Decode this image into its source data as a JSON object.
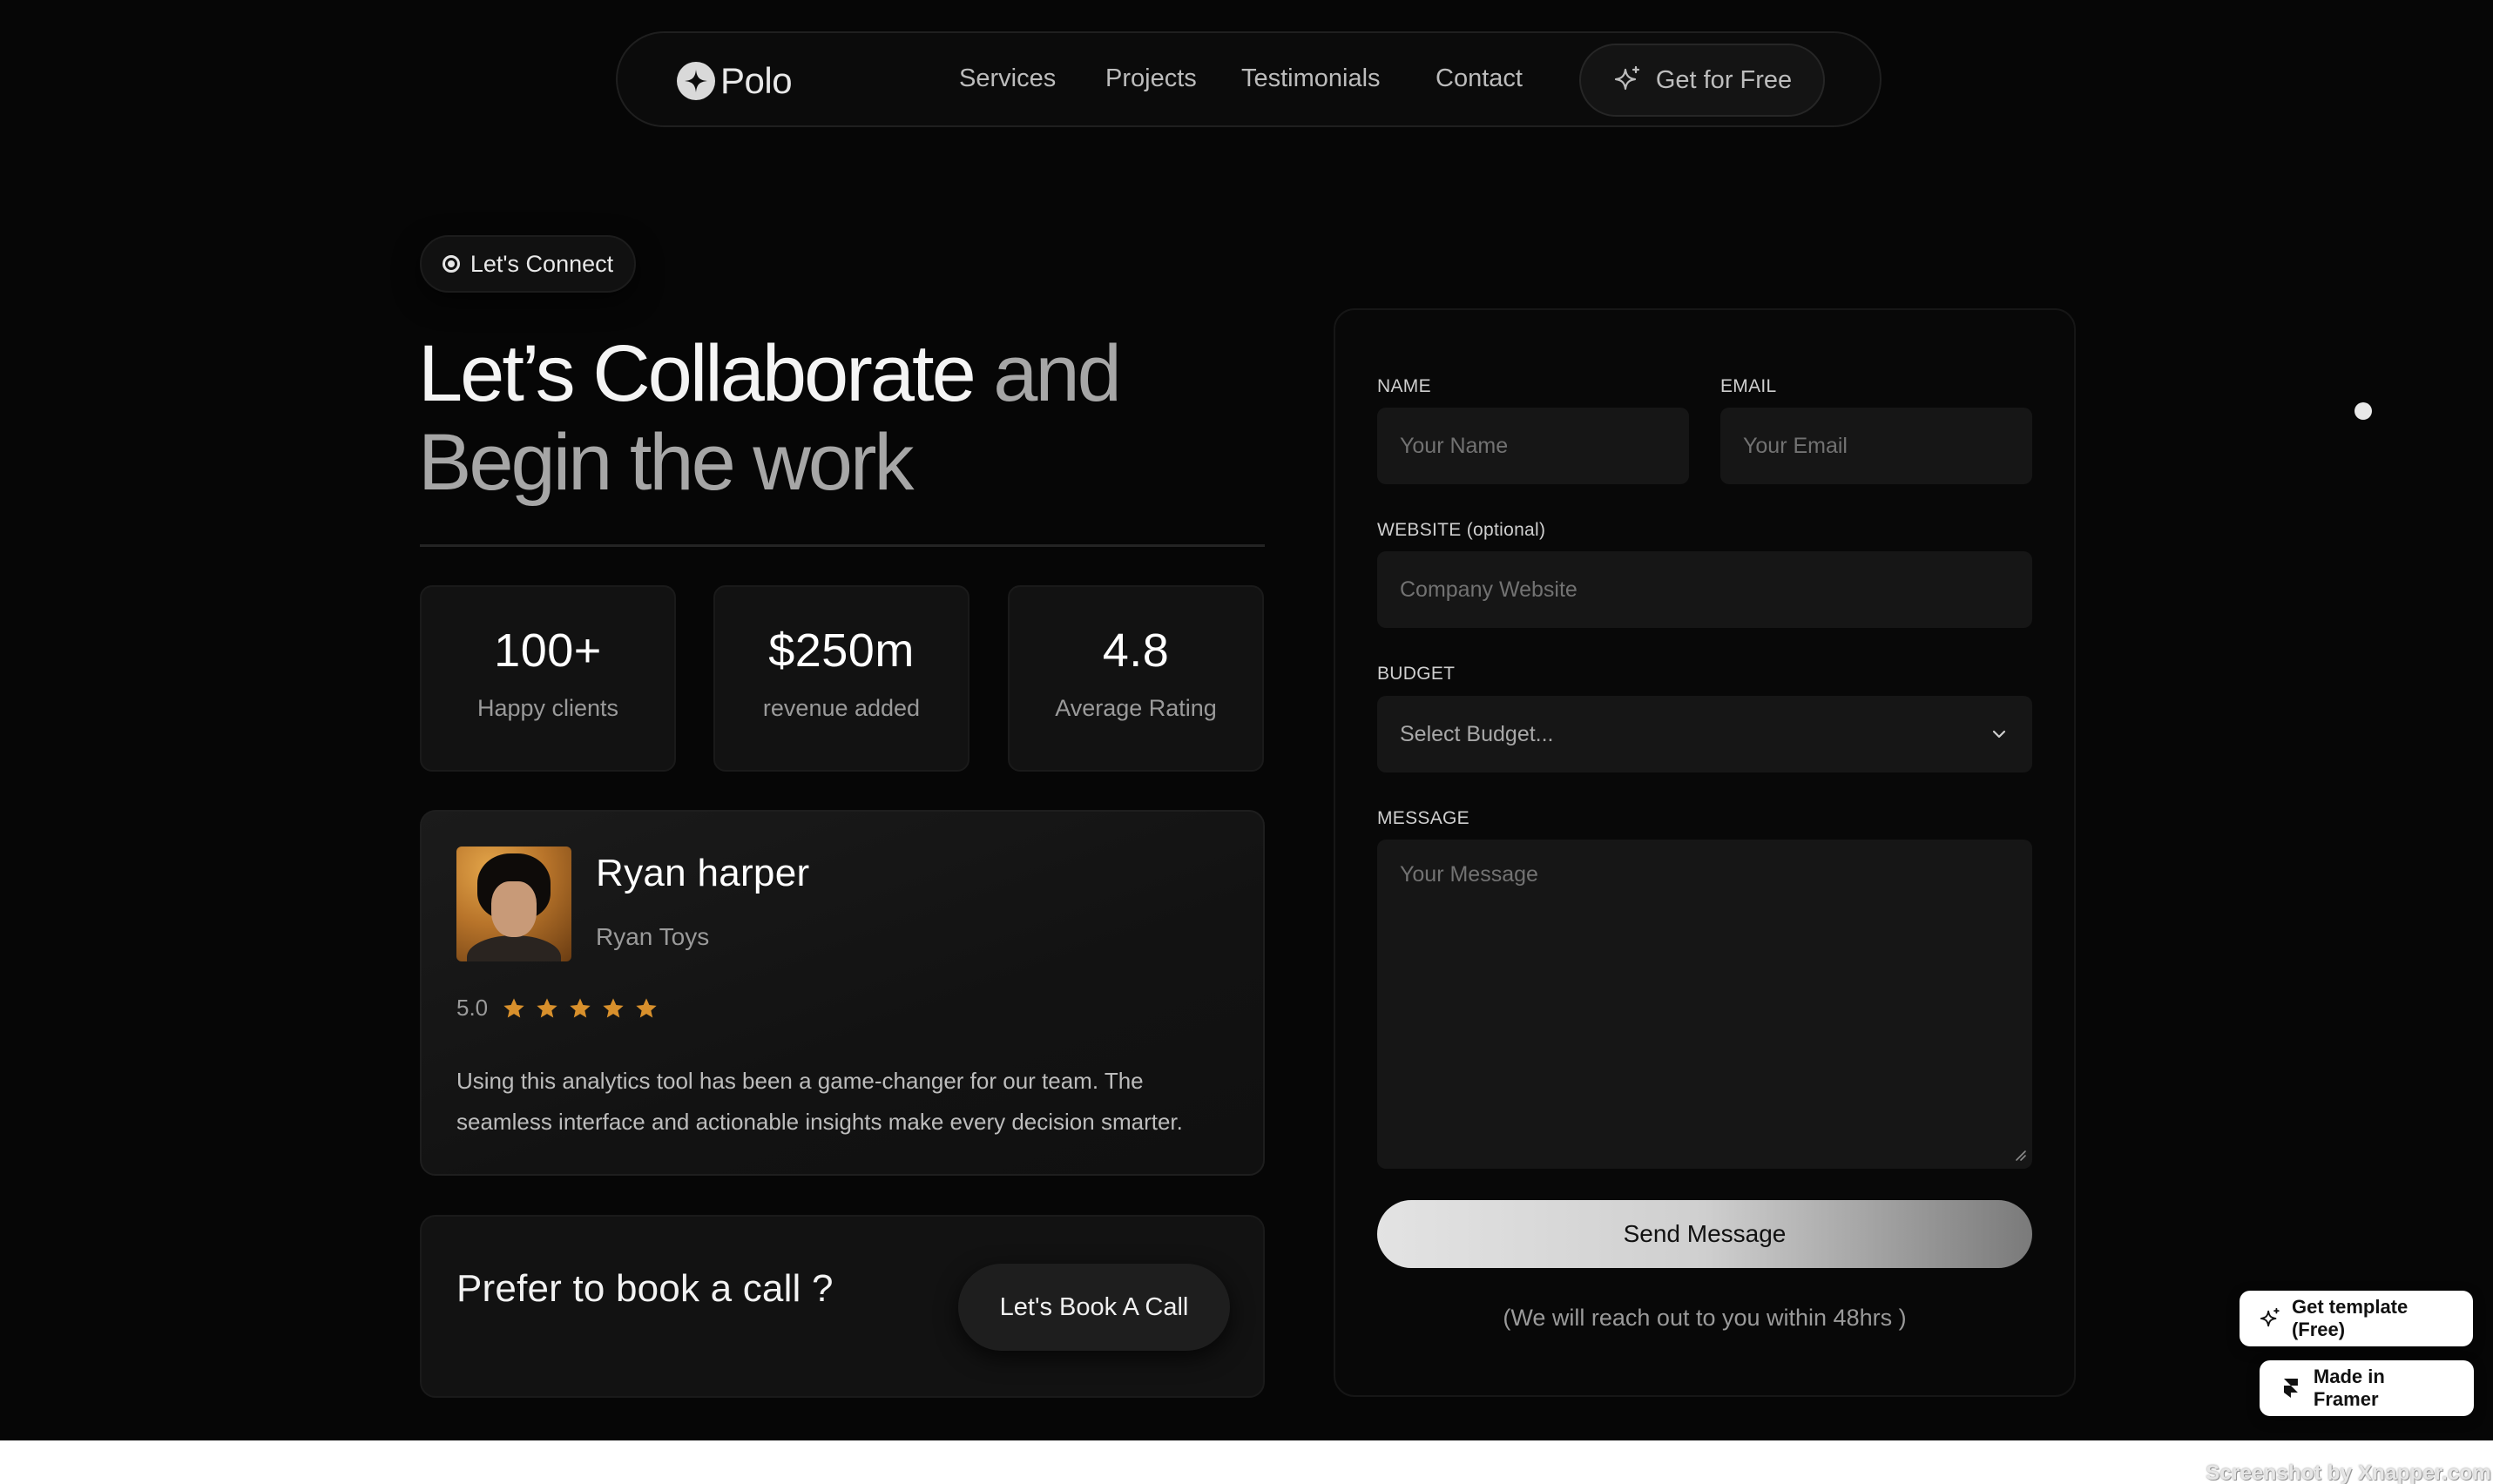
{
  "nav": {
    "brand": "Polo",
    "links": [
      "Services",
      "Projects",
      "Testimonials",
      "Contact"
    ],
    "cta_label": "Get for Free"
  },
  "hero": {
    "tag": "Let's Connect",
    "headline_strong_1": "Let’s Collaborate",
    "headline_muted_1": " and",
    "headline_muted_2": "Begin the work"
  },
  "stats": [
    {
      "value": "100+",
      "label": "Happy clients"
    },
    {
      "value": "$250m",
      "label": "revenue added"
    },
    {
      "value": "4.8",
      "label": "Average Rating"
    }
  ],
  "testimonial": {
    "name": "Ryan harper",
    "company": "Ryan Toys",
    "score": "5.0",
    "stars": 5,
    "quote": "Using this analytics tool has been a game-changer for our team. The seamless interface and actionable insights make every decision smarter."
  },
  "call": {
    "title": "Prefer to book a call ?",
    "button": "Let's Book A Call"
  },
  "form": {
    "name_label": "NAME",
    "name_placeholder": "Your Name",
    "email_label": "EMAIL",
    "email_placeholder": "Your Email",
    "website_label": "WEBSITE (optional)",
    "website_placeholder": "Company Website",
    "budget_label": "BUDGET",
    "budget_selected": "Select Budget...",
    "message_label": "MESSAGE",
    "message_placeholder": "Your Message",
    "submit": "Send Message",
    "note": "(We will reach out to you within 48hrs )"
  },
  "badges": {
    "template": "Get template (Free)",
    "framer": "Made in Framer"
  },
  "watermark": "Screenshot by Xnapper.com",
  "colors": {
    "background": "#060606",
    "card": "#121212",
    "star": "#d8902c",
    "text_muted": "#9a9a9a"
  }
}
